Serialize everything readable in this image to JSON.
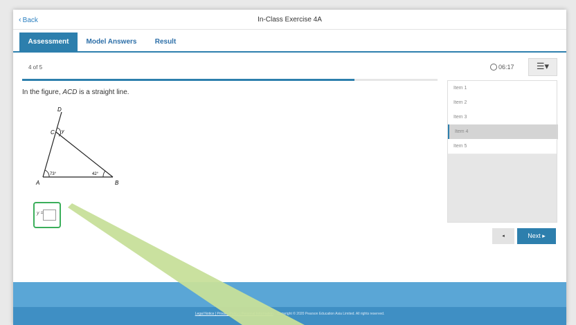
{
  "header": {
    "back_label": "Back",
    "title": "In-Class Exercise 4A"
  },
  "tabs": [
    {
      "label": "Assessment",
      "active": true
    },
    {
      "label": "Model Answers",
      "active": false
    },
    {
      "label": "Result",
      "active": false
    }
  ],
  "status": {
    "position_text": "4 of 5",
    "progress_fraction": 0.8,
    "timer": "06:17"
  },
  "question": {
    "prefix": "In the figure, ",
    "line_name": "ACD",
    "suffix": " is a straight line.",
    "figure": {
      "label_d": "D",
      "label_c": "C",
      "label_y": "y",
      "label_a": "A",
      "label_b": "B",
      "angle_a": "73°",
      "angle_b": "42°"
    },
    "answer_label": "y =",
    "answer_value": ""
  },
  "items": [
    {
      "label": "Item 1",
      "active": false
    },
    {
      "label": "Item 2",
      "active": false
    },
    {
      "label": "Item 3",
      "active": false
    },
    {
      "label": "Item 4",
      "active": true
    },
    {
      "label": "Item 5",
      "active": false
    }
  ],
  "nav": {
    "prev_label": "◂",
    "next_label": "Next ▸"
  },
  "footer": {
    "links": "Legal Notice | Privacy Policy | Personal Information",
    "copyright": "Copyright © 2020 Pearson Education Asia Limited. All rights reserved."
  },
  "colors": {
    "accent": "#2d7fad",
    "highlight_border": "#3aae5a",
    "pointer": "#c7df9a",
    "footer": "#5aa6d6"
  }
}
